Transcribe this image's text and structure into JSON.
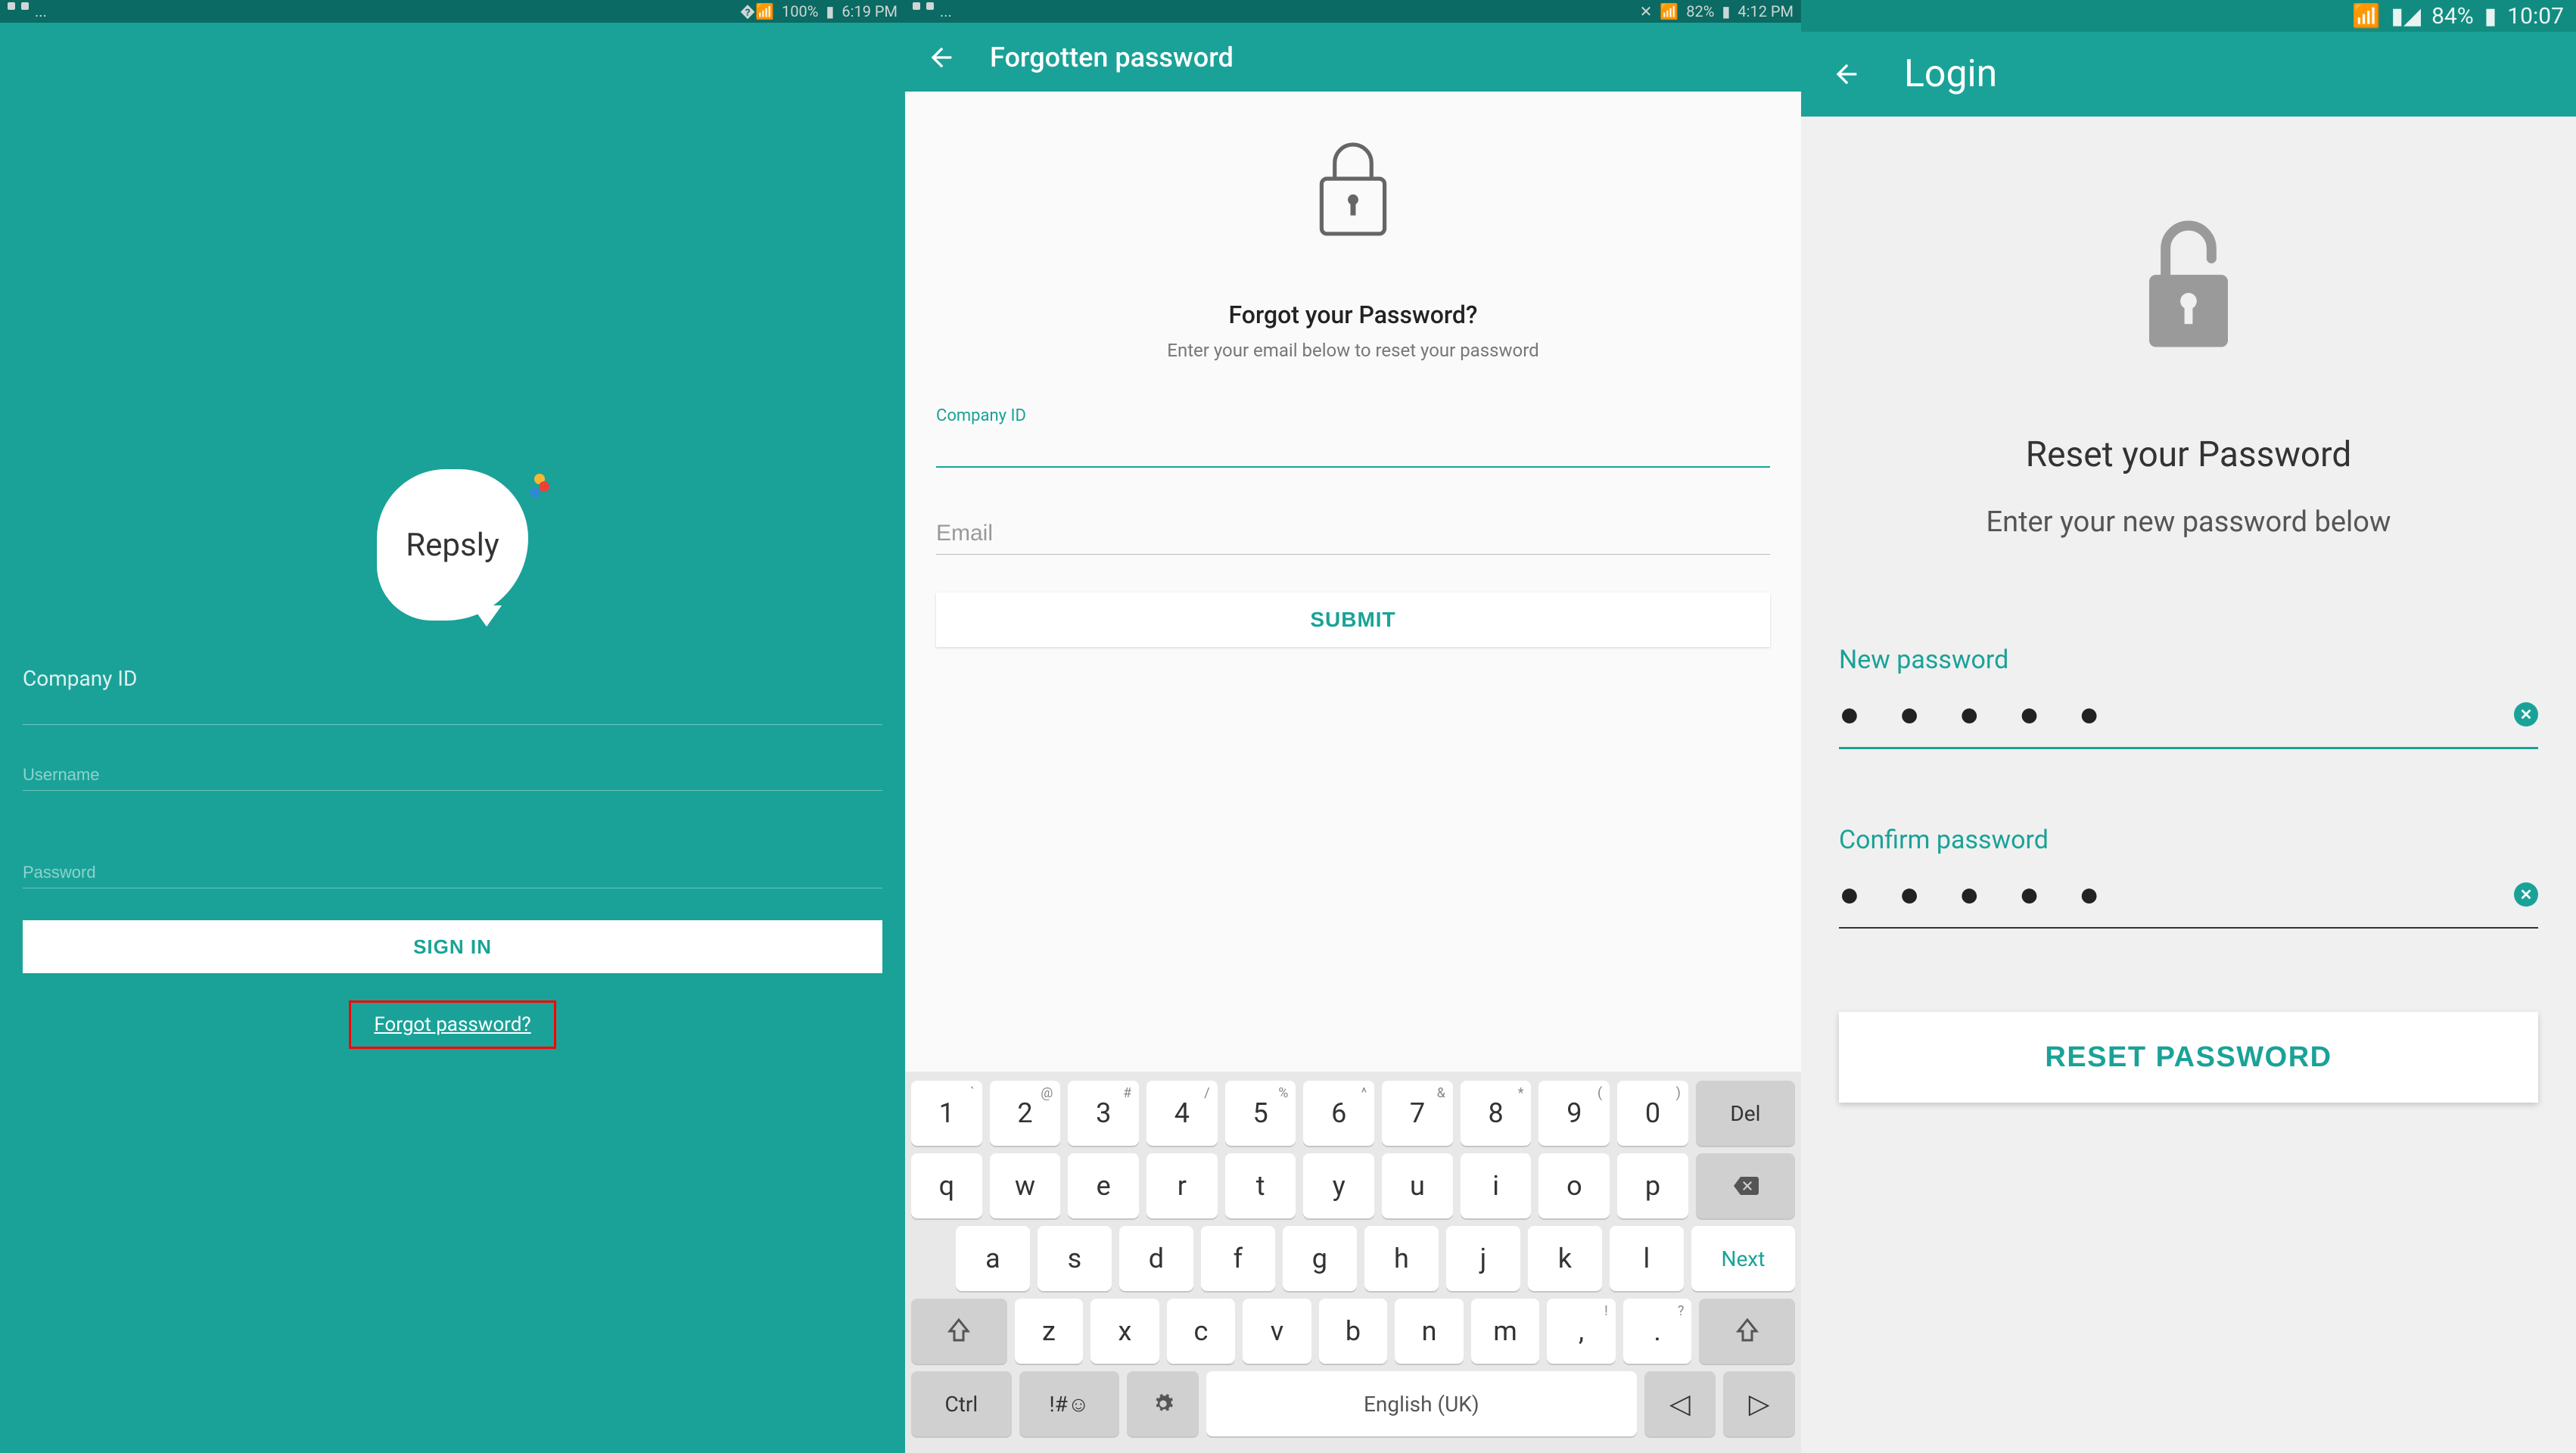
{
  "panel1": {
    "status": {
      "battery": "100%",
      "time": "6:19 PM",
      "ellipsis": "..."
    },
    "logo_text": "Repsly",
    "company_id_label": "Company ID",
    "username_placeholder": "Username",
    "password_placeholder": "Password",
    "signin_label": "SIGN IN",
    "forgot_label": "Forgot password?"
  },
  "panel2": {
    "status": {
      "battery": "82%",
      "time": "4:12 PM",
      "ellipsis": "..."
    },
    "appbar_title": "Forgotten password",
    "heading": "Forgot your Password?",
    "sub": "Enter your email below to reset your password",
    "company_id_label": "Company ID",
    "email_placeholder": "Email",
    "submit_label": "SUBMIT",
    "keyboard": {
      "row1": [
        {
          "k": "1",
          "s": "`"
        },
        {
          "k": "2",
          "s": "@"
        },
        {
          "k": "3",
          "s": "#"
        },
        {
          "k": "4",
          "s": "/"
        },
        {
          "k": "5",
          "s": "%"
        },
        {
          "k": "6",
          "s": "^"
        },
        {
          "k": "7",
          "s": "&"
        },
        {
          "k": "8",
          "s": "*"
        },
        {
          "k": "9",
          "s": "("
        },
        {
          "k": "0",
          "s": ")"
        }
      ],
      "del": "Del",
      "row2": [
        "q",
        "w",
        "e",
        "r",
        "t",
        "y",
        "u",
        "i",
        "o",
        "p"
      ],
      "row3": [
        "a",
        "s",
        "d",
        "f",
        "g",
        "h",
        "j",
        "k",
        "l"
      ],
      "next": "Next",
      "row4": [
        "z",
        "x",
        "c",
        "v",
        "b",
        "n",
        "m"
      ],
      "comma_sup": "!",
      "period_sup": "?",
      "ctrl": "Ctrl",
      "sym": "!#☺",
      "lang": "English (UK)"
    }
  },
  "panel3": {
    "status": {
      "battery": "84%",
      "time": "10:07"
    },
    "appbar_title": "Login",
    "heading": "Reset your Password",
    "sub": "Enter your new password below",
    "new_pwd_label": "New password",
    "confirm_pwd_label": "Confirm password",
    "masked": "● ● ● ● ●",
    "reset_label": "RESET PASSWORD"
  }
}
